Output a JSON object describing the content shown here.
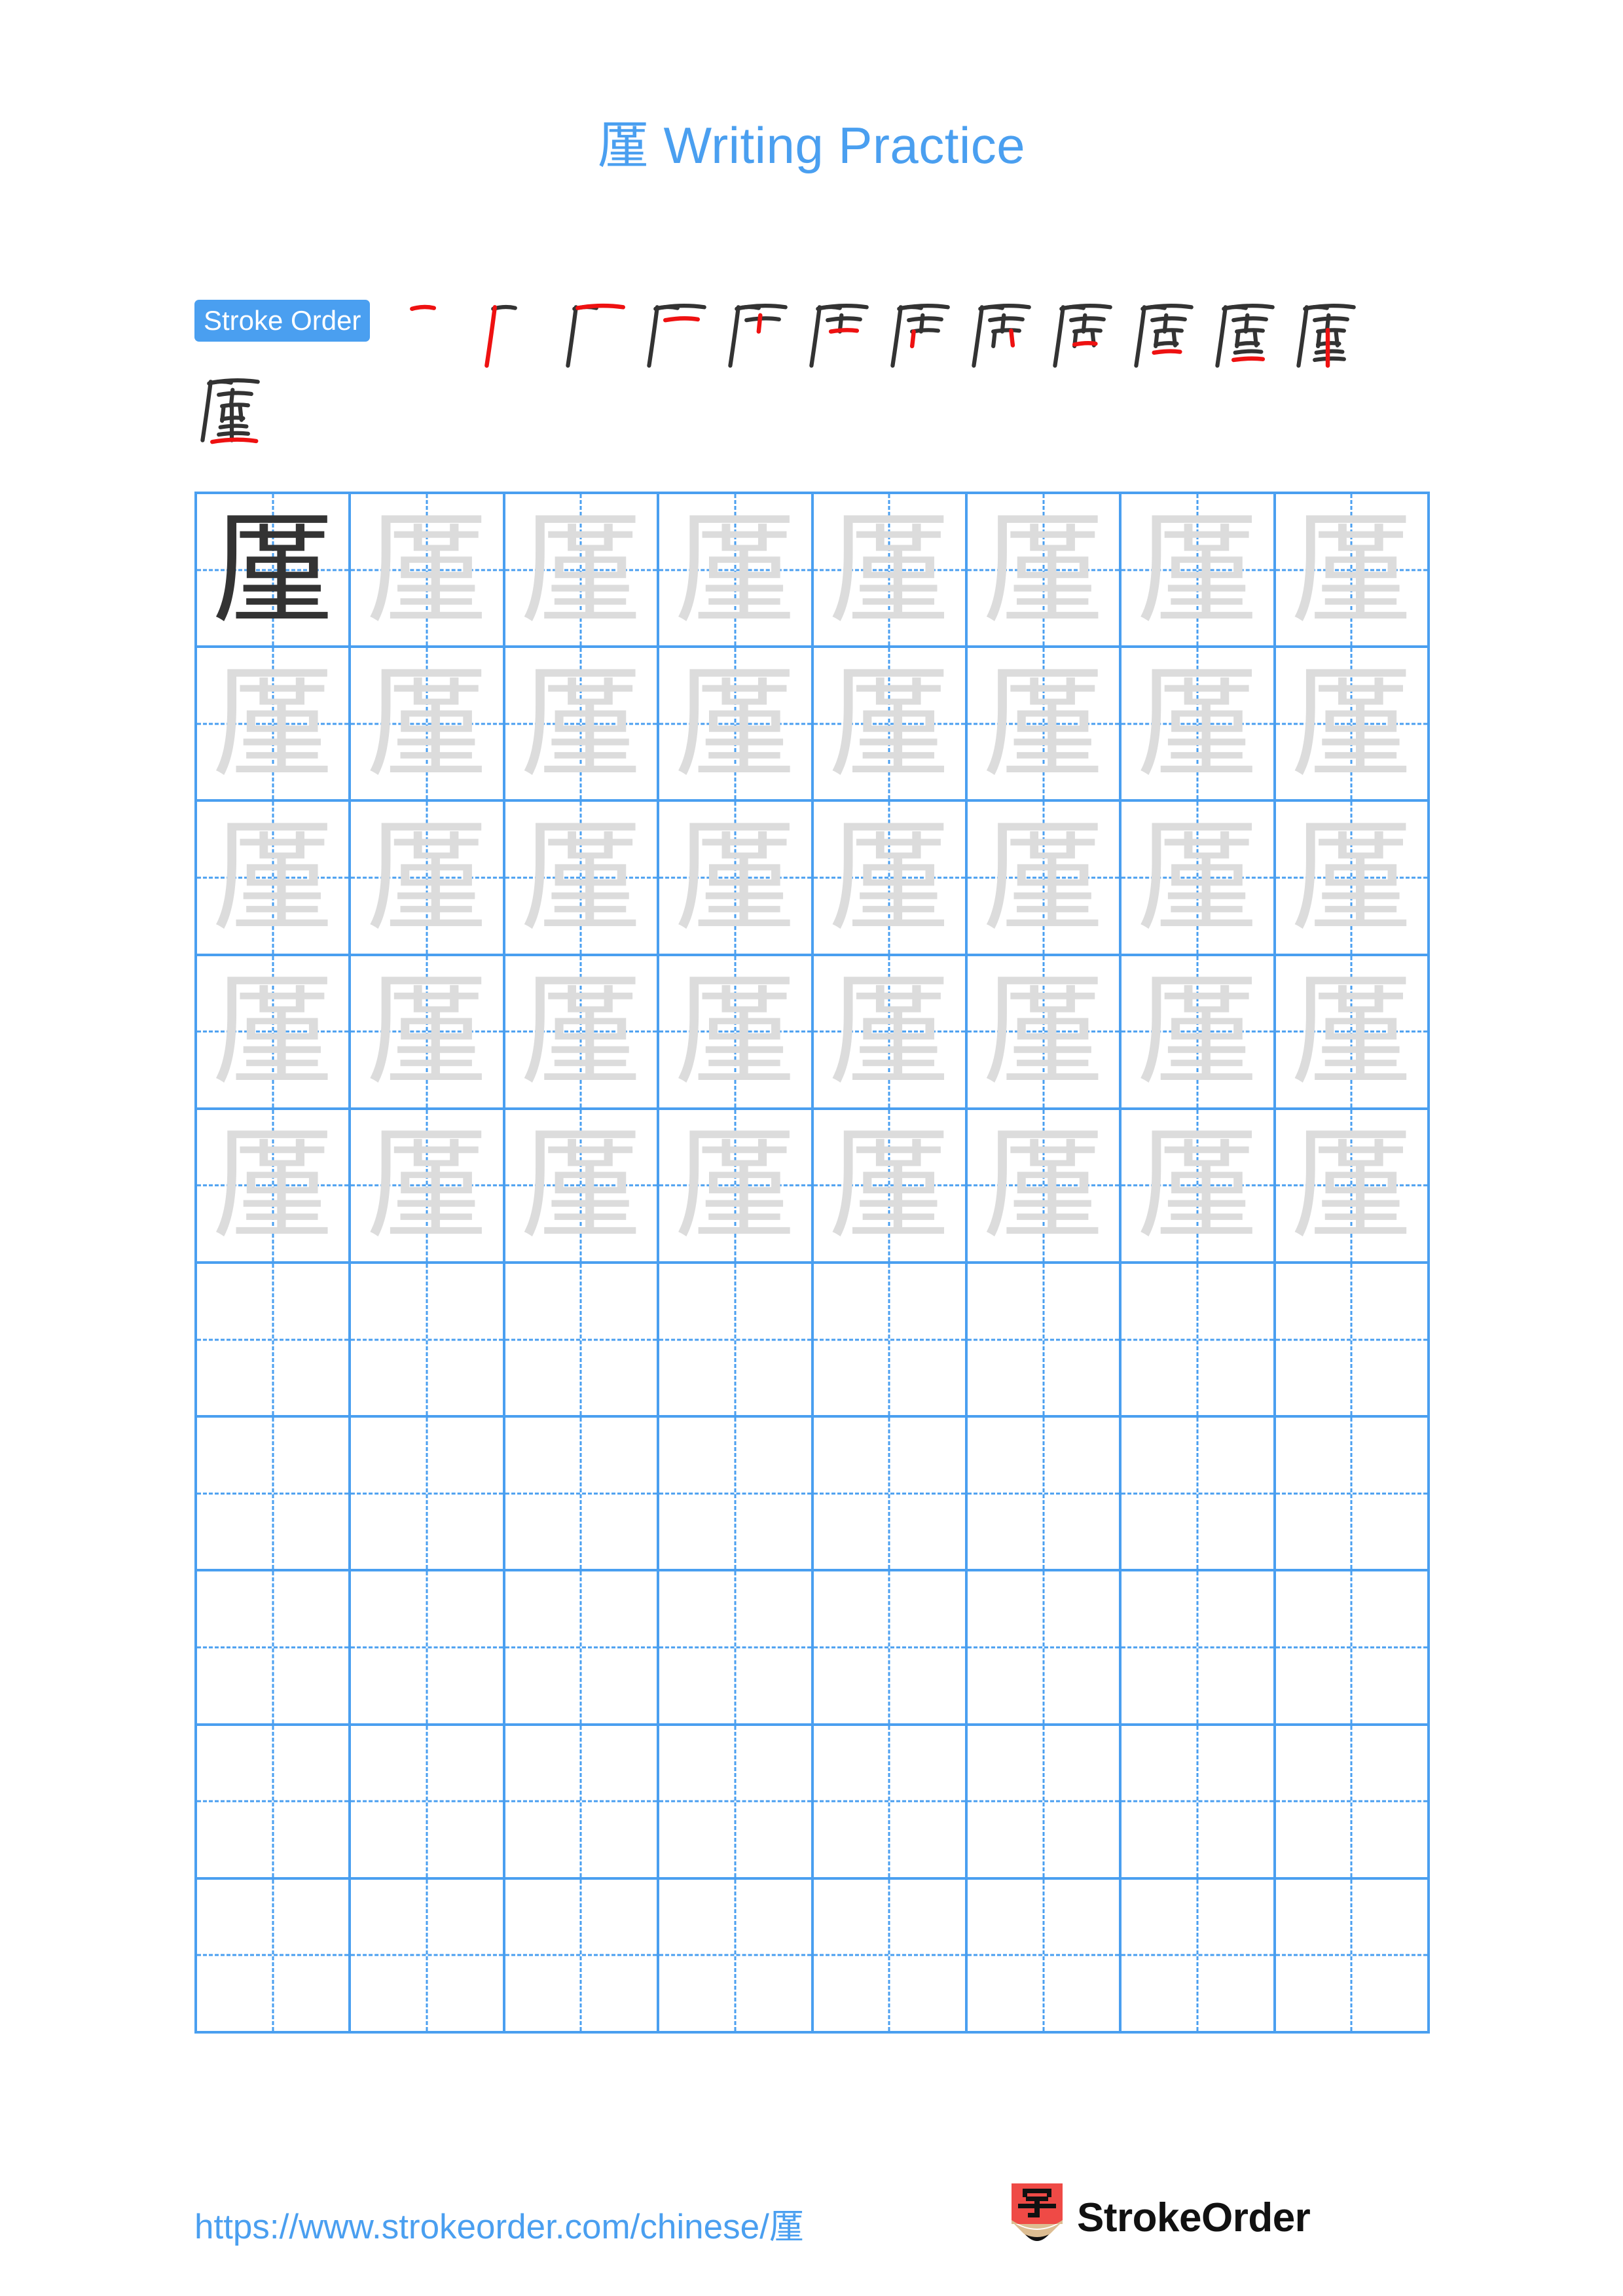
{
  "document": {
    "type": "chinese-character-writing-practice-worksheet",
    "character": "厪",
    "background_color": "#ffffff"
  },
  "title": {
    "character": "厪",
    "text": "Writing Practice",
    "full": "厪 Writing Practice",
    "color": "#4a9ff0"
  },
  "stroke_order": {
    "badge_label": "Stroke Order",
    "badge_background": "#4a9ff0",
    "badge_text_color": "#ffffff",
    "total_strokes": 13,
    "new_stroke_color": "#ee1111",
    "prior_stroke_color": "#333333",
    "steps": [
      {
        "index": 1,
        "glyph": "一",
        "strokes_shown": 1
      },
      {
        "index": 2,
        "glyph": "厂",
        "strokes_shown": 2
      },
      {
        "index": 3,
        "glyph": "厂一",
        "strokes_shown": 3
      },
      {
        "index": 4,
        "glyph": "厈",
        "strokes_shown": 4
      },
      {
        "index": 5,
        "glyph": "严",
        "strokes_shown": 5
      },
      {
        "index": 6,
        "glyph": "严",
        "strokes_shown": 6
      },
      {
        "index": 7,
        "glyph": "严",
        "strokes_shown": 7
      },
      {
        "index": 8,
        "glyph": "厏",
        "strokes_shown": 8
      },
      {
        "index": 9,
        "glyph": "厔",
        "strokes_shown": 9
      },
      {
        "index": 10,
        "glyph": "厝",
        "strokes_shown": 10
      },
      {
        "index": 11,
        "glyph": "厝",
        "strokes_shown": 11
      },
      {
        "index": 12,
        "glyph": "厪",
        "strokes_shown": 12
      },
      {
        "index": 13,
        "glyph": "厪",
        "strokes_shown": 13
      }
    ]
  },
  "practice_grid": {
    "columns": 8,
    "rows": 10,
    "border_color": "#4a9ff0",
    "guide_color": "#4a9ff0",
    "model_char_color": "#333333",
    "trace_char_color": "#dcdcdc",
    "cells": [
      [
        "model",
        "trace",
        "trace",
        "trace",
        "trace",
        "trace",
        "trace",
        "trace"
      ],
      [
        "trace",
        "trace",
        "trace",
        "trace",
        "trace",
        "trace",
        "trace",
        "trace"
      ],
      [
        "trace",
        "trace",
        "trace",
        "trace",
        "trace",
        "trace",
        "trace",
        "trace"
      ],
      [
        "trace",
        "trace",
        "trace",
        "trace",
        "trace",
        "trace",
        "trace",
        "trace"
      ],
      [
        "trace",
        "trace",
        "trace",
        "trace",
        "trace",
        "trace",
        "trace",
        "trace"
      ],
      [
        "blank",
        "blank",
        "blank",
        "blank",
        "blank",
        "blank",
        "blank",
        "blank"
      ],
      [
        "blank",
        "blank",
        "blank",
        "blank",
        "blank",
        "blank",
        "blank",
        "blank"
      ],
      [
        "blank",
        "blank",
        "blank",
        "blank",
        "blank",
        "blank",
        "blank",
        "blank"
      ],
      [
        "blank",
        "blank",
        "blank",
        "blank",
        "blank",
        "blank",
        "blank",
        "blank"
      ],
      [
        "blank",
        "blank",
        "blank",
        "blank",
        "blank",
        "blank",
        "blank",
        "blank"
      ]
    ]
  },
  "footer": {
    "url": "https://www.strokeorder.com/chinese/厪",
    "url_color": "#4a9ff0",
    "logo": {
      "glyph": "字",
      "brand": "StrokeOrder",
      "body_color": "#ef4a46",
      "wood_color": "#ddbd92",
      "tip_color": "#111111",
      "brand_color": "#111111"
    }
  }
}
